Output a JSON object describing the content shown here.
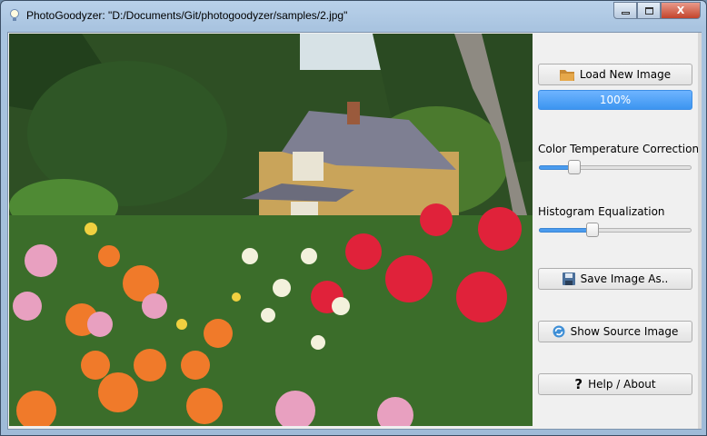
{
  "window": {
    "title": "PhotoGoodyzer: \"D:/Documents/Git/photogoodyzer/samples/2.jpg\"",
    "icon": "lightbulb-icon",
    "minimize": "minimize-icon",
    "maximize": "maximize-icon",
    "close": "close-icon"
  },
  "panel": {
    "load_button": {
      "label": "Load New Image",
      "icon": "folder-icon"
    },
    "progress": {
      "text": "100%",
      "value": 100
    },
    "color_temp": {
      "label": "Color Temperature Correction",
      "value": 0.23
    },
    "histogram": {
      "label": "Histogram Equalization",
      "value": 0.35
    },
    "save_button": {
      "label": "Save Image As..",
      "icon": "floppy-disk-icon"
    },
    "source_button": {
      "label": "Show Source Image",
      "icon": "refresh-icon"
    },
    "help_button": {
      "label": "Help / About",
      "icon": "question-mark-icon"
    }
  },
  "colors": {
    "accent": "#3c95f0"
  }
}
